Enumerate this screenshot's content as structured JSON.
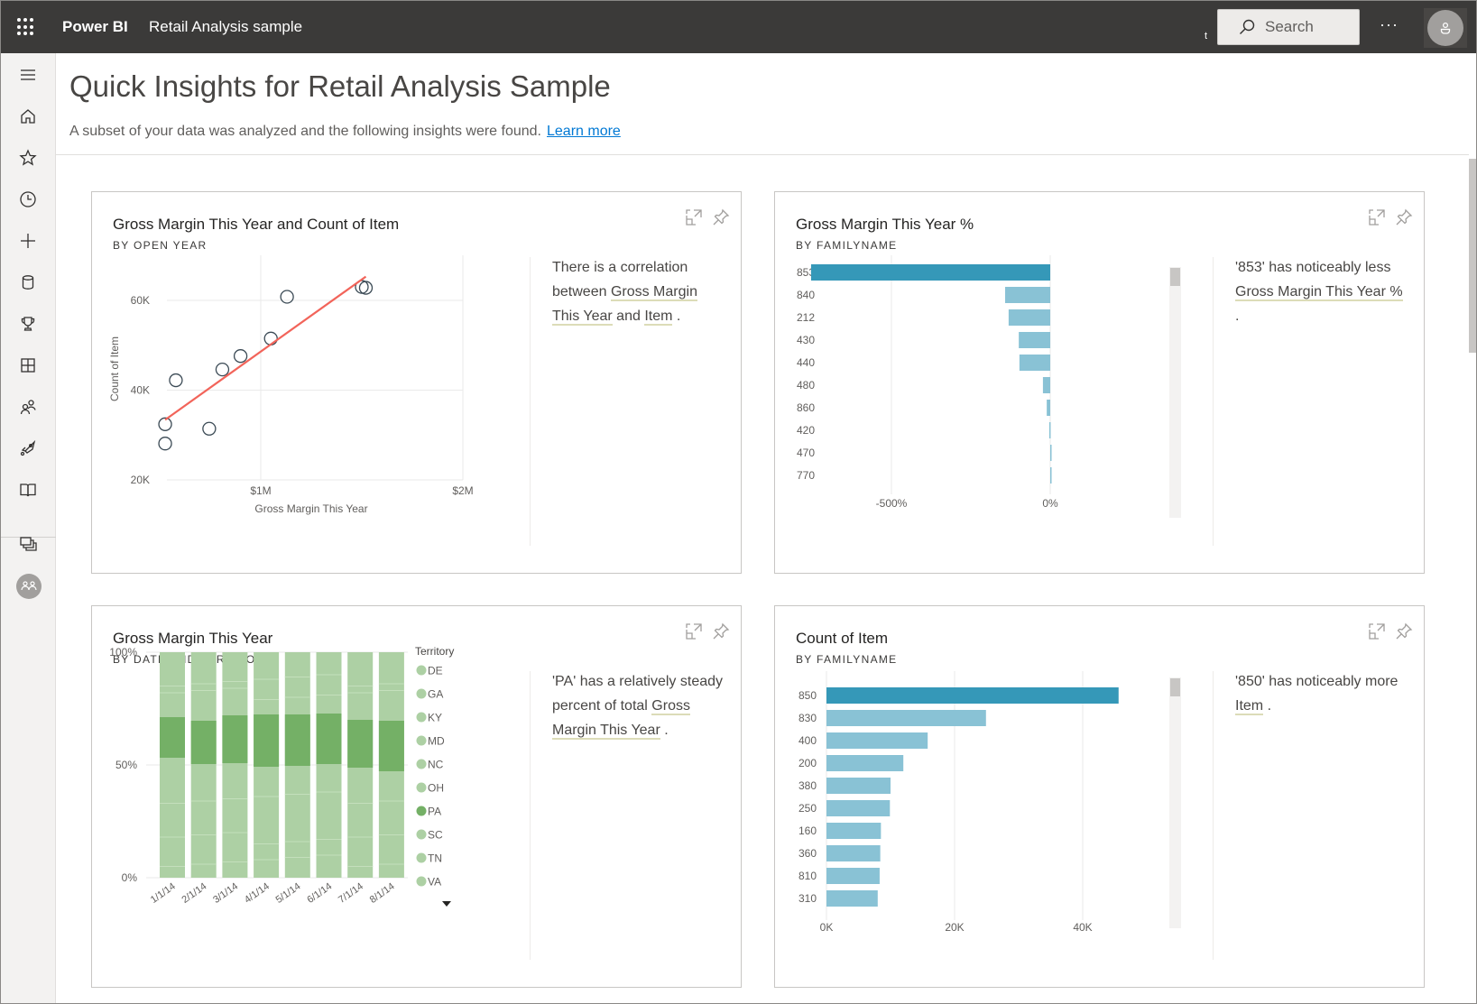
{
  "topbar": {
    "app_name": "Power BI",
    "report_name": "Retail Analysis sample",
    "stray_char": "t",
    "search_label": "Search",
    "more_label": "···"
  },
  "leftnav": {
    "items": [
      {
        "icon": "hamburger-icon",
        "label": "Expand navigation"
      },
      {
        "icon": "home-icon",
        "label": "Home"
      },
      {
        "icon": "star-icon",
        "label": "Favorites"
      },
      {
        "icon": "clock-icon",
        "label": "Recent"
      },
      {
        "icon": "plus-icon",
        "label": "Create"
      },
      {
        "icon": "database-icon",
        "label": "Datasets"
      },
      {
        "icon": "trophy-icon",
        "label": "Goals"
      },
      {
        "icon": "apps-icon",
        "label": "Apps"
      },
      {
        "icon": "people-icon",
        "label": "Shared with me"
      },
      {
        "icon": "rocket-icon",
        "label": "Deployment pipelines"
      },
      {
        "icon": "book-icon",
        "label": "Learn"
      },
      {
        "icon": "workspaces-icon",
        "label": "Workspaces"
      },
      {
        "icon": "my-workspace-icon",
        "label": "My workspace"
      }
    ]
  },
  "page": {
    "title": "Quick Insights for Retail Analysis Sample",
    "subtitle": "A subset of your data was analyzed and the following insights were found.",
    "learn_more": "Learn more"
  },
  "colors": {
    "accent_bar": "#3598b8",
    "bar": "#89c2d5",
    "trend": "#f2645a",
    "stack_light": "#add0a4",
    "stack_dark": "#74b066",
    "link": "#0078d4"
  },
  "cards": [
    {
      "title": "Gross Margin This Year and Count of Item",
      "subtitle": "BY OPEN YEAR",
      "insight_parts": [
        {
          "t": "There is a correlation between ",
          "u": false
        },
        {
          "t": "Gross Margin This Year",
          "u": true
        },
        {
          "t": " and ",
          "u": false
        },
        {
          "t": "Item",
          "u": true
        },
        {
          "t": " .",
          "u": false
        }
      ]
    },
    {
      "title": "Gross Margin This Year %",
      "subtitle": "BY FAMILYNAME",
      "insight_parts": [
        {
          "t": "'853' has noticeably less ",
          "u": false
        },
        {
          "t": "Gross Margin This Year %",
          "u": true
        },
        {
          "t": " .",
          "u": false
        }
      ]
    },
    {
      "title": "Gross Margin This Year",
      "subtitle": "BY DATE AND TERRITORY",
      "insight_parts": [
        {
          "t": "'PA' has a relatively steady percent of total ",
          "u": false
        },
        {
          "t": "Gross Margin This Year",
          "u": true
        },
        {
          "t": " .",
          "u": false
        }
      ]
    },
    {
      "title": "Count of Item",
      "subtitle": "BY FAMILYNAME",
      "insight_parts": [
        {
          "t": "'850' has noticeably more ",
          "u": false
        },
        {
          "t": "Item",
          "u": true
        },
        {
          "t": " .",
          "u": false
        }
      ]
    }
  ],
  "chart_data": [
    {
      "type": "scatter",
      "title": "Gross Margin This Year and Count of Item",
      "subtitle": "BY OPEN YEAR",
      "xlabel": "Gross Margin This Year",
      "ylabel": "Count of Item",
      "x_ticks": [
        {
          "v": 1000000,
          "label": "$1M"
        },
        {
          "v": 2000000,
          "label": "$2M"
        }
      ],
      "y_ticks": [
        {
          "v": 20000,
          "label": "20K"
        },
        {
          "v": 40000,
          "label": "40K"
        },
        {
          "v": 60000,
          "label": "60K"
        }
      ],
      "xlim": [
        530000,
        2000000
      ],
      "ylim": [
        20000,
        68000
      ],
      "grid": true,
      "points": [
        {
          "x": 527000,
          "y": 32400
        },
        {
          "x": 527000,
          "y": 28100
        },
        {
          "x": 580000,
          "y": 42200
        },
        {
          "x": 745000,
          "y": 31400
        },
        {
          "x": 810000,
          "y": 44600
        },
        {
          "x": 900000,
          "y": 47600
        },
        {
          "x": 1050000,
          "y": 51500
        },
        {
          "x": 1130000,
          "y": 60800
        },
        {
          "x": 1500000,
          "y": 63000
        },
        {
          "x": 1520000,
          "y": 62800
        }
      ],
      "trendline": [
        {
          "x": 527000,
          "y": 33400
        },
        {
          "x": 1520000,
          "y": 65300
        }
      ]
    },
    {
      "type": "bar",
      "orientation": "horizontal",
      "title": "Gross Margin This Year %",
      "subtitle": "BY FAMILYNAME",
      "categories": [
        "853",
        "840",
        "212",
        "430",
        "440",
        "480",
        "860",
        "420",
        "470",
        "770"
      ],
      "values": [
        -753,
        -142,
        -131,
        -99,
        -97,
        -23,
        -11,
        -3,
        1,
        3
      ],
      "highlight": "853",
      "x_ticks": [
        {
          "v": -500,
          "label": "-500%"
        },
        {
          "v": 0,
          "label": "0%"
        }
      ],
      "xlim": [
        -1000,
        0
      ],
      "grid": true
    },
    {
      "type": "bar",
      "stacked": "100%",
      "title": "Gross Margin This Year",
      "subtitle": "BY DATE AND TERRITORY",
      "categories": [
        "1/1/14",
        "2/1/14",
        "3/1/14",
        "4/1/14",
        "5/1/14",
        "6/1/14",
        "7/1/14",
        "8/1/14"
      ],
      "y_ticks": [
        "0%",
        "50%",
        "100%"
      ],
      "ylim": [
        0,
        100
      ],
      "legend_title": "Territory",
      "legend": [
        "DE",
        "GA",
        "KY",
        "MD",
        "NC",
        "OH",
        "PA",
        "SC",
        "TN",
        "VA"
      ],
      "legend_position": "right",
      "highlight": "PA",
      "pa_segment": [
        {
          "bottom": 53.2,
          "top": 71.2
        },
        {
          "bottom": 50.4,
          "top": 69.6
        },
        {
          "bottom": 50.8,
          "top": 72.0
        },
        {
          "bottom": 49.2,
          "top": 72.4
        },
        {
          "bottom": 49.6,
          "top": 72.4
        },
        {
          "bottom": 50.4,
          "top": 72.8
        },
        {
          "bottom": 48.8,
          "top": 70.0
        },
        {
          "bottom": 47.2,
          "top": 69.6
        }
      ]
    },
    {
      "type": "bar",
      "orientation": "horizontal",
      "title": "Count of Item",
      "subtitle": "BY FAMILYNAME",
      "categories": [
        "850",
        "830",
        "400",
        "200",
        "380",
        "250",
        "160",
        "360",
        "810",
        "310"
      ],
      "values": [
        45600,
        24900,
        15800,
        12000,
        10000,
        9900,
        8500,
        8400,
        8300,
        8000
      ],
      "highlight": "850",
      "x_ticks": [
        {
          "v": 0,
          "label": "0K"
        },
        {
          "v": 20000,
          "label": "20K"
        },
        {
          "v": 40000,
          "label": "40K"
        }
      ],
      "xlim": [
        0,
        46000
      ],
      "grid": true
    }
  ]
}
